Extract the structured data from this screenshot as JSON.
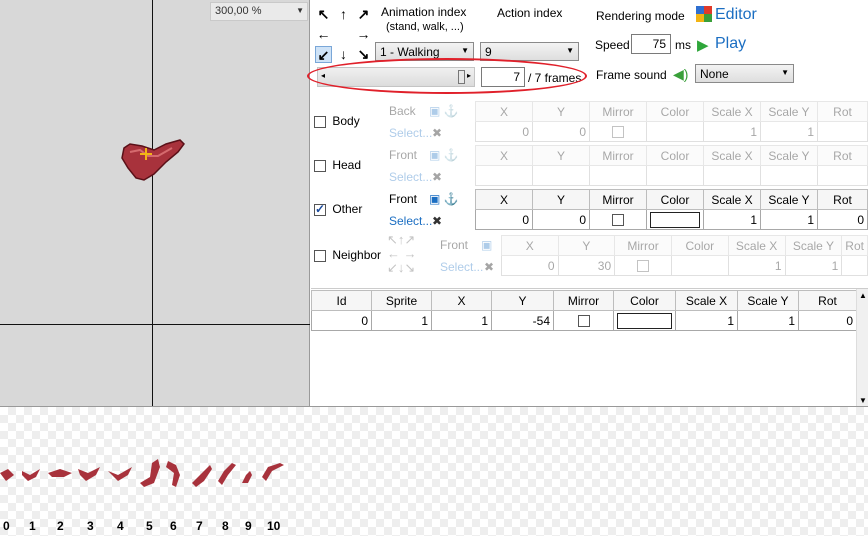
{
  "canvas": {
    "zoom": "300,00 %"
  },
  "animation": {
    "animation_index_label": "Animation index",
    "animation_index_sub": "(stand, walk, ...)",
    "animation_selected": "1 - Walking",
    "action_index_label": "Action index",
    "action_selected": "9",
    "frame_value": "7",
    "frame_total": "/ 7 frames",
    "frame_progress": 1.0
  },
  "rendering": {
    "mode_label": "Rendering mode",
    "editor_label": "Editor",
    "speed_label": "Speed",
    "speed_value": "75",
    "speed_unit": "ms",
    "play_label": "Play",
    "sound_label": "Frame sound",
    "sound_selected": "None"
  },
  "layers": {
    "headers": [
      "X",
      "Y",
      "Mirror",
      "Color",
      "Scale X",
      "Scale Y",
      "Rot"
    ],
    "body": {
      "label": "Body",
      "side": "Back",
      "select": "Select...",
      "x": "0",
      "y": "0",
      "scalex": "1",
      "scaley": "1",
      "rot": ""
    },
    "head": {
      "label": "Head",
      "side": "Front",
      "select": "Select...",
      "x": "",
      "y": "",
      "scalex": "",
      "scaley": "",
      "rot": ""
    },
    "other": {
      "label": "Other",
      "side": "Front",
      "select": "Select...",
      "x": "0",
      "y": "0",
      "scalex": "1",
      "scaley": "1",
      "rot": "0"
    },
    "neighbor": {
      "label": "Neighbor",
      "side": "Front",
      "select": "Select...",
      "x": "0",
      "y": "30",
      "scalex": "1",
      "scaley": "1"
    }
  },
  "sprite_table": {
    "headers": [
      "Id",
      "Sprite",
      "X",
      "Y",
      "Mirror",
      "Color",
      "Scale X",
      "Scale Y",
      "Rot"
    ],
    "row": {
      "id": "0",
      "sprite": "1",
      "x": "1",
      "y": "-54",
      "scalex": "1",
      "scaley": "1",
      "rot": "0"
    }
  },
  "strip": {
    "labels": [
      "0",
      "1",
      "2",
      "3",
      "4",
      "5",
      "6",
      "7",
      "8",
      "9",
      "10"
    ]
  },
  "colors": {
    "sprite": "#a8323c",
    "accent": "#1b6ec2",
    "highlight": "#e0202a"
  }
}
